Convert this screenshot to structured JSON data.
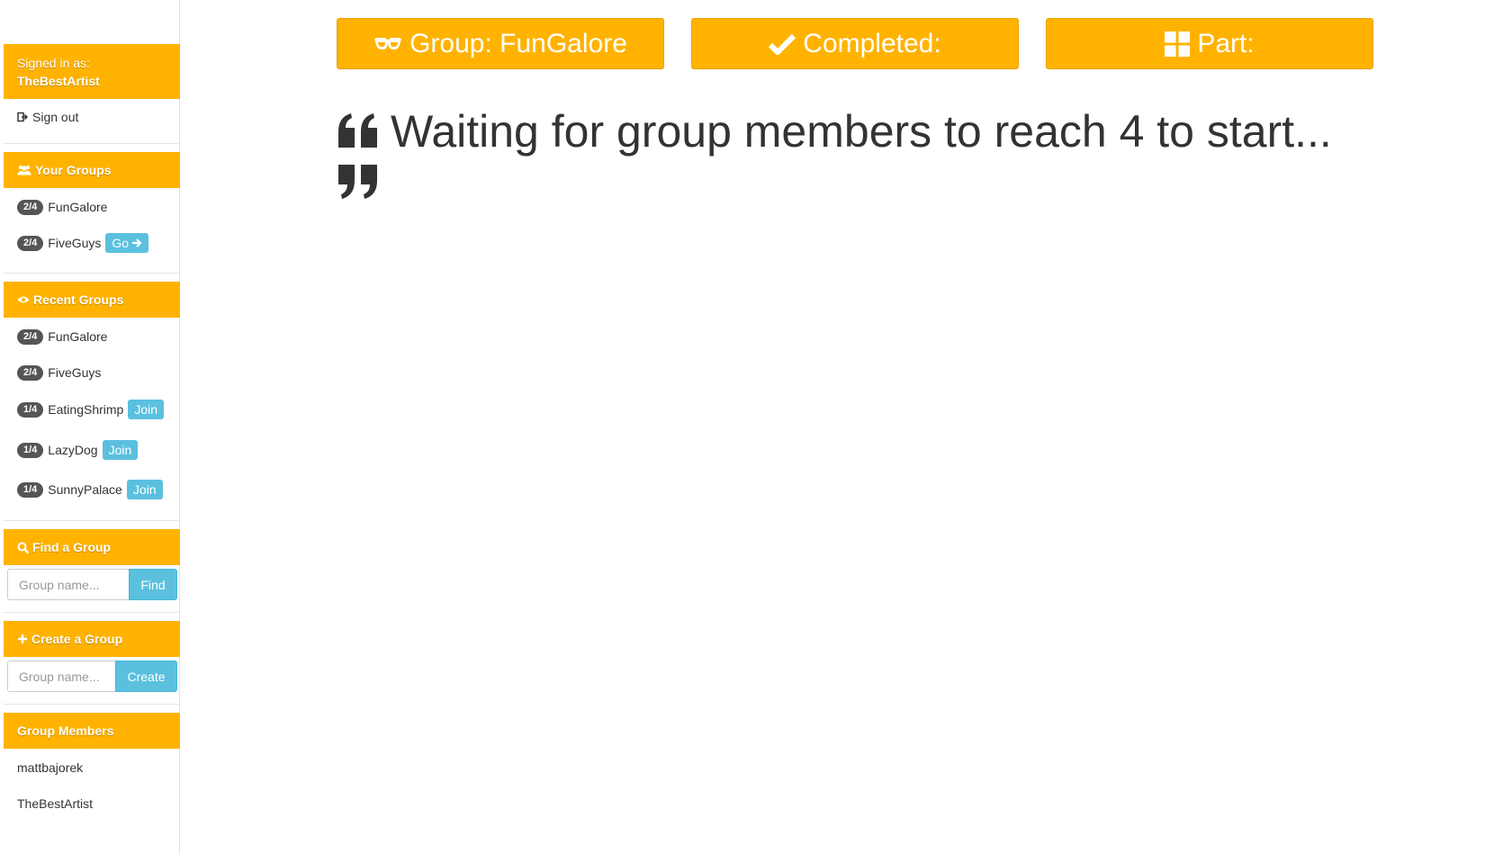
{
  "sidebar": {
    "signed_in": {
      "label": "Signed in as:",
      "user": "TheBestArtist"
    },
    "sign_out": "Sign out",
    "your_groups": {
      "title": "Your Groups",
      "items": [
        {
          "badge": "2/4",
          "name": "FunGalore"
        },
        {
          "badge": "2/4",
          "name": "FiveGuys",
          "action": "Go"
        }
      ]
    },
    "recent_groups": {
      "title": "Recent Groups",
      "items": [
        {
          "badge": "2/4",
          "name": "FunGalore"
        },
        {
          "badge": "2/4",
          "name": "FiveGuys"
        },
        {
          "badge": "1/4",
          "name": "EatingShrimp",
          "action": "Join"
        },
        {
          "badge": "1/4",
          "name": "LazyDog",
          "action": "Join"
        },
        {
          "badge": "1/4",
          "name": "SunnyPalace",
          "action": "Join"
        }
      ]
    },
    "find_group": {
      "title": "Find a Group",
      "placeholder": "Group name...",
      "button": "Find"
    },
    "create_group": {
      "title": "Create a Group",
      "placeholder": "Group name...",
      "button": "Create"
    },
    "group_members": {
      "title": "Group Members",
      "members": [
        "mattbajorek",
        "TheBestArtist"
      ]
    }
  },
  "main": {
    "group_button": "Group: FunGalore",
    "completed_button": "Completed:",
    "part_button": "Part:",
    "waiting_message": "Waiting for group members to reach 4 to start..."
  },
  "colors": {
    "accent": "#ffb300",
    "info": "#5bc0de",
    "badge": "#555555"
  },
  "icons": {
    "sign_out": "sign-out-icon",
    "your_groups": "users-icon",
    "recent_groups": "eye-icon",
    "find": "search-icon",
    "create": "plus-icon",
    "group": "glasses-icon",
    "completed": "check-icon",
    "part": "grid-icon"
  }
}
